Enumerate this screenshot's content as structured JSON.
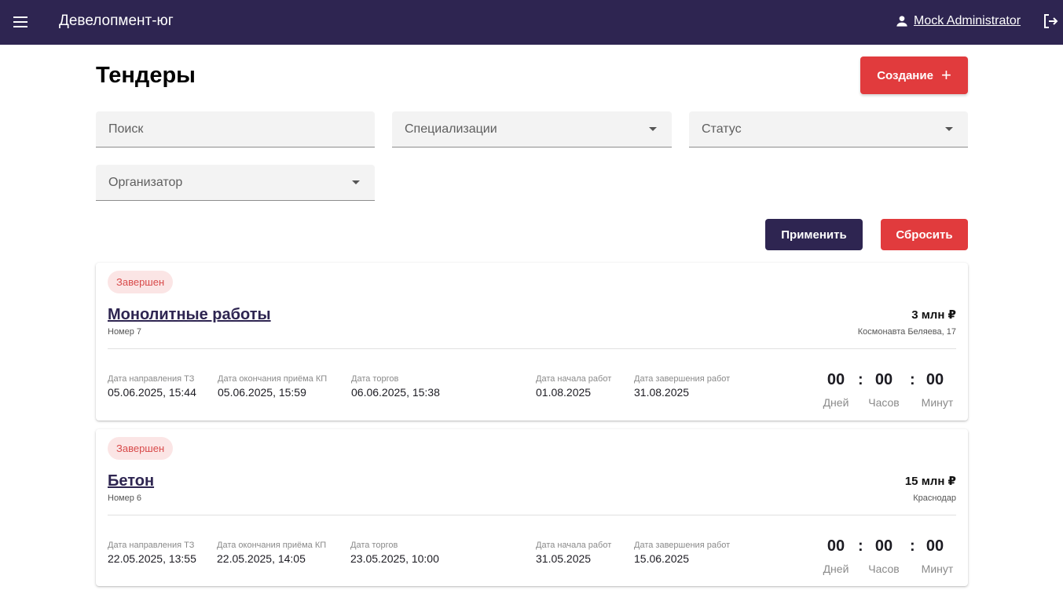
{
  "header": {
    "app_title": "Девелопмент-юг",
    "user_name": "Mock Administrator",
    "menu_icon": "menu-icon",
    "user_icon": "person-icon",
    "logout_icon": "logout-icon"
  },
  "page": {
    "title": "Тендеры",
    "create_label": "Создание",
    "create_icon": "+"
  },
  "filters": {
    "search_placeholder": "Поиск",
    "specializations_placeholder": "Специализации",
    "status_placeholder": "Статус",
    "organizer_placeholder": "Организатор",
    "apply_label": "Применить",
    "reset_label": "Сбросить"
  },
  "labels": {
    "tz_date": "Дата направления ТЗ",
    "kp_end": "Дата окончания приёма КП",
    "auction": "Дата торгов",
    "work_start": "Дата начала работ",
    "work_end": "Дата завершения работ",
    "days": "Дней",
    "hours": "Часов",
    "minutes": "Минут"
  },
  "tenders": [
    {
      "status": "Завершен",
      "title": "Монолитные работы",
      "number": "Номер 7",
      "price": "3 млн ₽",
      "address": "Космонавта Беляева, 17",
      "tz_date": "05.06.2025, 15:44",
      "kp_end": "05.06.2025, 15:59",
      "auction": "06.06.2025, 15:38",
      "work_start": "01.08.2025",
      "work_end": "31.08.2025",
      "days": "00",
      "hours": "00",
      "minutes": "00"
    },
    {
      "status": "Завершен",
      "title": "Бетон",
      "number": "Номер 6",
      "price": "15 млн ₽",
      "address": "Краснодар",
      "tz_date": "22.05.2025, 13:55",
      "kp_end": "22.05.2025, 14:05",
      "auction": "23.05.2025, 10:00",
      "work_start": "31.05.2025",
      "work_end": "15.06.2025",
      "days": "00",
      "hours": "00",
      "minutes": "00"
    }
  ],
  "colors": {
    "topbar": "#2e2551",
    "accent_red": "#e13b3d",
    "badge_bg": "#fbe5e5",
    "badge_text": "#d84a4a"
  }
}
